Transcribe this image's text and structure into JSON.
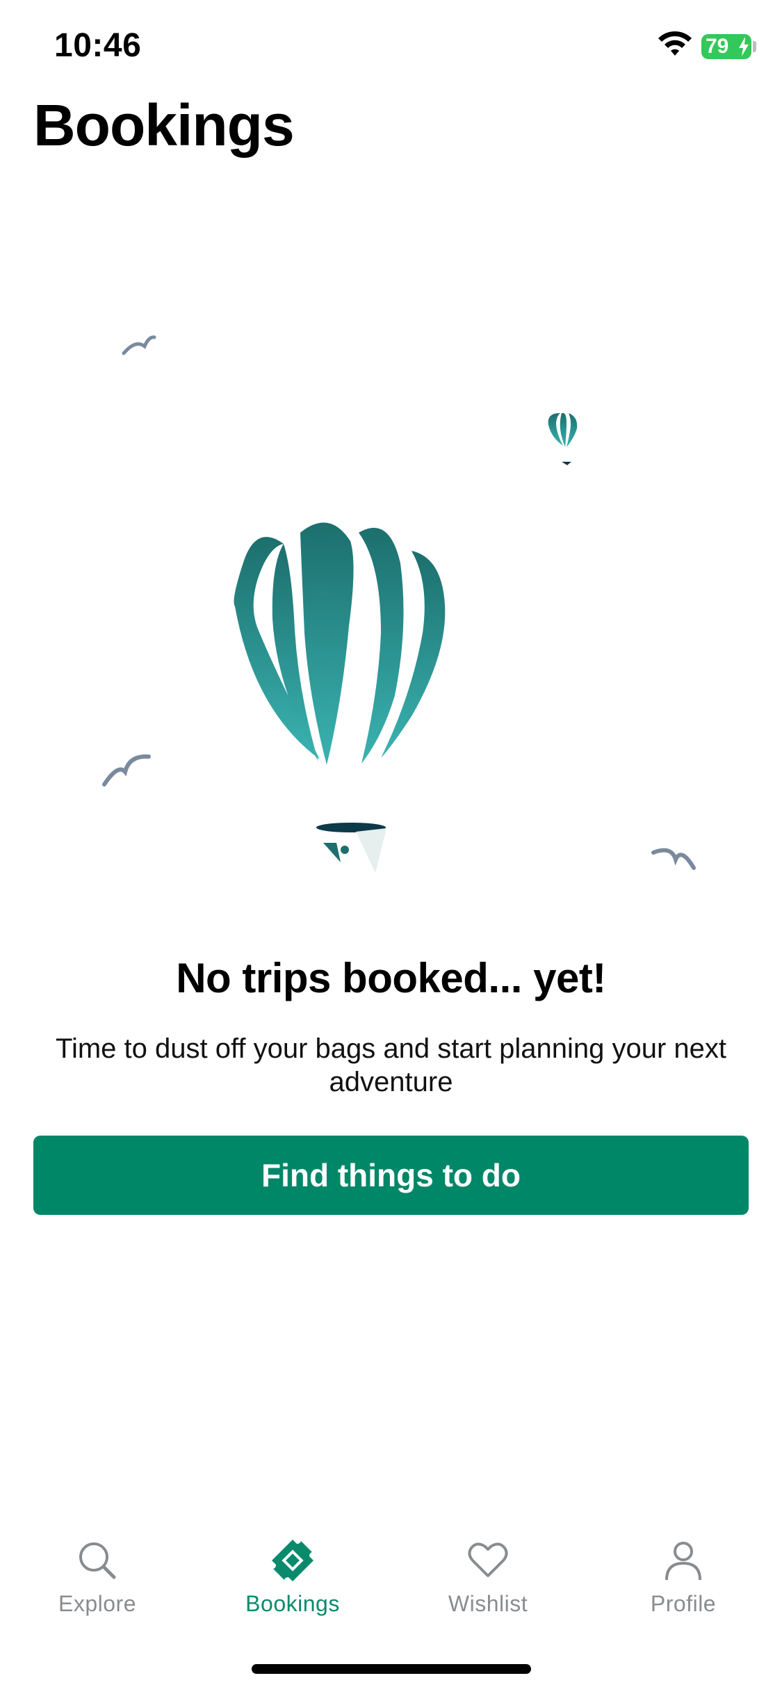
{
  "status_bar": {
    "time": "10:46",
    "battery_level": "79",
    "battery_charging": true,
    "battery_color": "#34c759",
    "wifi_icon": "wifi-icon"
  },
  "header": {
    "title": "Bookings"
  },
  "empty_state": {
    "heading": "No trips booked... yet!",
    "description": "Time to dust off your bags and start planning your next adventure",
    "button_label": "Find things to do",
    "illustration_icon": "hot-air-balloon-icon"
  },
  "tab_bar": {
    "active_tab": "Bookings",
    "active_color": "#0a8a6c",
    "inactive_color": "#888c90",
    "items": [
      {
        "label": "Explore",
        "icon": "search-icon"
      },
      {
        "label": "Bookings",
        "icon": "ticket-icon"
      },
      {
        "label": "Wishlist",
        "icon": "heart-icon"
      },
      {
        "label": "Profile",
        "icon": "person-icon"
      }
    ]
  },
  "colors": {
    "brand": "#008768",
    "balloon_dark": "#1c6f6d",
    "balloon_light": "#3ab3b1",
    "bird": "#7a8a9c"
  }
}
